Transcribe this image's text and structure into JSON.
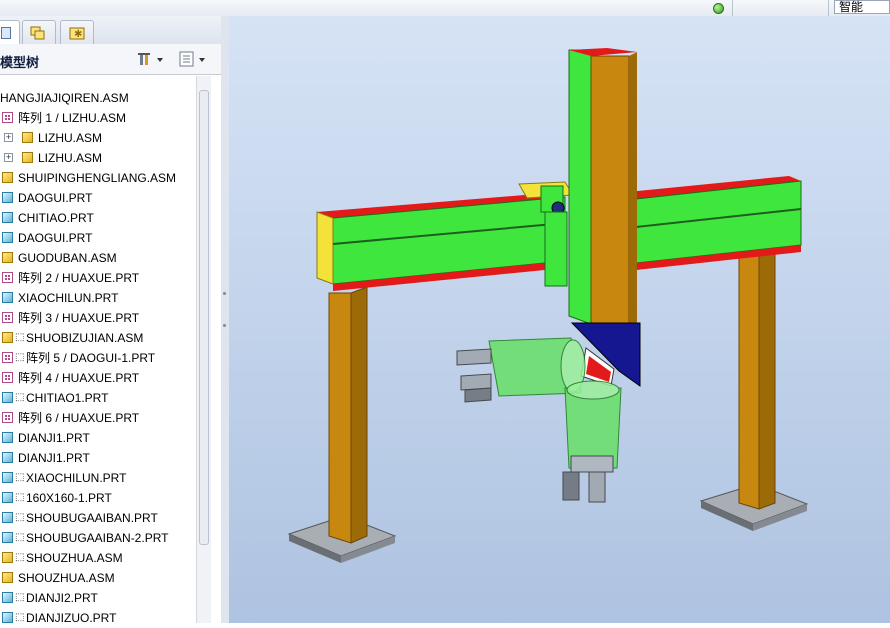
{
  "toolbar": {
    "filter_value": "智能"
  },
  "navigator": {
    "title": "模型树",
    "tabs": [
      {
        "icon": "model-tree-tab-icon"
      },
      {
        "icon": "folder-browser-tab-icon"
      },
      {
        "icon": "favorites-tab-icon"
      }
    ],
    "settings_icon": "tree-settings-icon",
    "show_icon": "tree-show-icon"
  },
  "tree": {
    "root": "HANGJIAJIQIREN.ASM",
    "items": [
      {
        "label": "阵列 1 / LIZHU.ASM",
        "type": "pattern"
      },
      {
        "label": "LIZHU.ASM",
        "type": "asm",
        "child": true
      },
      {
        "label": "LIZHU.ASM",
        "type": "asm",
        "child": true
      },
      {
        "label": "SHUIPINGHENGLIANG.ASM",
        "type": "asm"
      },
      {
        "label": "DAOGUI.PRT",
        "type": "prt"
      },
      {
        "label": "CHITIAO.PRT",
        "type": "prt"
      },
      {
        "label": "DAOGUI.PRT",
        "type": "prt"
      },
      {
        "label": "GUODUBAN.ASM",
        "type": "asm"
      },
      {
        "label": "阵列 2 / HUAXUE.PRT",
        "type": "pattern"
      },
      {
        "label": "XIAOCHILUN.PRT",
        "type": "prt"
      },
      {
        "label": "阵列 3 / HUAXUE.PRT",
        "type": "pattern"
      },
      {
        "label": "SHUOBIZUJIAN.ASM",
        "type": "asm",
        "glyph": true
      },
      {
        "label": "阵列 5 / DAOGUI-1.PRT",
        "type": "pattern",
        "glyph": true
      },
      {
        "label": "阵列 4 / HUAXUE.PRT",
        "type": "pattern"
      },
      {
        "label": "CHITIAO1.PRT",
        "type": "prt",
        "glyph": true
      },
      {
        "label": "阵列 6 / HUAXUE.PRT",
        "type": "pattern"
      },
      {
        "label": "DIANJI1.PRT",
        "type": "prt"
      },
      {
        "label": "DIANJI1.PRT",
        "type": "prt"
      },
      {
        "label": "XIAOCHILUN.PRT",
        "type": "prt",
        "glyph": true
      },
      {
        "label": "160X160-1.PRT",
        "type": "prt",
        "glyph": true
      },
      {
        "label": "SHOUBUGAAIBAN.PRT",
        "type": "prt",
        "glyph": true
      },
      {
        "label": "SHOUBUGAAIBAN-2.PRT",
        "type": "prt",
        "glyph": true
      },
      {
        "label": "SHOUZHUA.ASM",
        "type": "asm",
        "glyph": true
      },
      {
        "label": "SHOUZHUA.ASM",
        "type": "asm"
      },
      {
        "label": "DIANJI2.PRT",
        "type": "prt",
        "glyph": true
      },
      {
        "label": "DIANJIZUO.PRT",
        "type": "prt",
        "glyph": true
      }
    ]
  },
  "viewport": {
    "colors": {
      "background_top": "#d6e3f5",
      "background_bottom": "#aec3e1",
      "column": "#c8880f",
      "beam": "#3ee63e",
      "rail": "#e21a1a",
      "bracket": "#f2e23a",
      "wedge": "#14178f"
    }
  }
}
